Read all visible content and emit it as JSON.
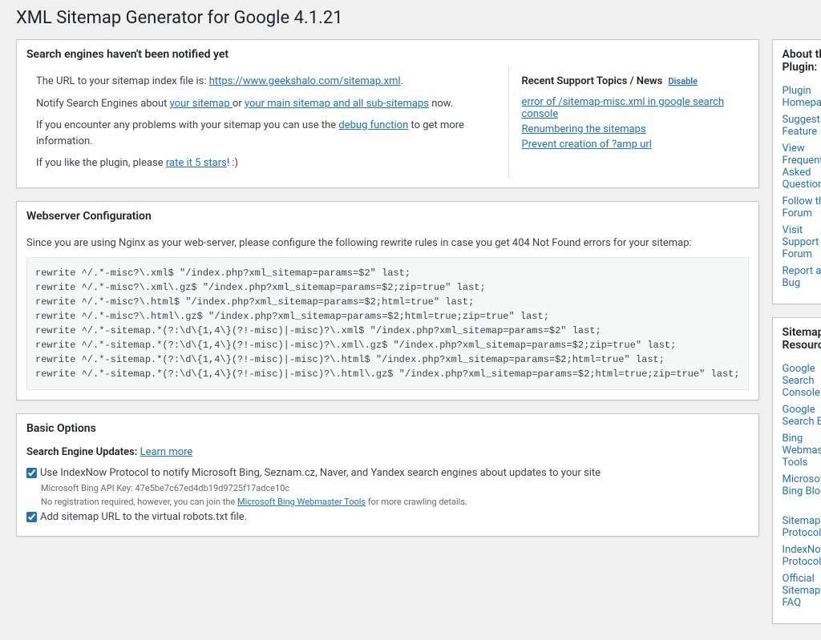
{
  "page_title": "XML Sitemap Generator for Google 4.1.21",
  "notify": {
    "heading": "Search engines haven't been notified yet",
    "line1_a": "The URL to your sitemap index file is: ",
    "line1_link": "https://www.geekshalo.com/sitemap.xml",
    "line1_b": ".",
    "line2_a": "Notify Search Engines about ",
    "line2_link1": "your sitemap ",
    "line2_mid": "or ",
    "line2_link2": "your main sitemap and all sub-sitemaps",
    "line2_b": " now.",
    "line3_a": "If you encounter any problems with your sitemap you can use the ",
    "line3_link": "debug function",
    "line3_b": " to get more information.",
    "line4_a": "If you like the plugin, please ",
    "line4_link": "rate it 5 stars",
    "line4_b": "! :)",
    "support_heading": "Recent Support Topics / News",
    "support_disable": "Disable",
    "support_items": [
      "error of /sitemap-misc.xml in google search console",
      "Renumbering the sitemaps",
      "Prevent creation of ?amp url"
    ]
  },
  "webserver": {
    "heading": "Webserver Configuration",
    "intro": "Since you are using Nginx as your web-server, please configure the following rewrite rules in case you get 404 Not Found errors for your sitemap:",
    "rules": "rewrite ^/.*-misc?\\.xml$ \"/index.php?xml_sitemap=params=$2\" last;\nrewrite ^/.*-misc?\\.xml\\.gz$ \"/index.php?xml_sitemap=params=$2;zip=true\" last;\nrewrite ^/.*-misc?\\.html$ \"/index.php?xml_sitemap=params=$2;html=true\" last;\nrewrite ^/.*-misc?\\.html\\.gz$ \"/index.php?xml_sitemap=params=$2;html=true;zip=true\" last;\nrewrite ^/.*-sitemap.*(?:\\d\\{1,4\\}(?!-misc)|-misc)?\\.xml$ \"/index.php?xml_sitemap=params=$2\" last;\nrewrite ^/.*-sitemap.*(?:\\d\\{1,4\\}(?!-misc)|-misc)?\\.xml\\.gz$ \"/index.php?xml_sitemap=params=$2;zip=true\" last;\nrewrite ^/.*-sitemap.*(?:\\d\\{1,4\\}(?!-misc)|-misc)?\\.html$ \"/index.php?xml_sitemap=params=$2;html=true\" last;\nrewrite ^/.*-sitemap.*(?:\\d\\{1,4\\}(?!-misc)|-misc)?\\.html\\.gz$ \"/index.php?xml_sitemap=params=$2;html=true;zip=true\" last;"
  },
  "basic": {
    "heading": "Basic Options",
    "sub_heading": "Search Engine Updates:",
    "learn_more": "Learn more",
    "opt_indexnow": "Use IndexNow Protocol to notify Microsoft Bing, Seznam.cz, Naver, and Yandex search engines about updates to your site",
    "bing_key_label": "Microsoft Bing API Key: 47e5be7c67ed4db19d9725f17adce10c",
    "bing_note_a": "No registration required, however, you can join the ",
    "bing_note_link": "Microsoft Bing Webmaster Tools",
    "bing_note_b": " for more crawling details.",
    "opt_robots": "Add sitemap URL to the virtual robots.txt file."
  },
  "about": {
    "heading": "About this Plugin:",
    "links": [
      "Plugin Homepage",
      "Suggest a Feature",
      "View Frequently Asked Questions",
      "Follow the Forum",
      "Visit Support Forum",
      "Report a Bug"
    ]
  },
  "resources": {
    "heading": "Sitemap Resources:",
    "group1": [
      "Google Search Console",
      "Google Search Blog",
      "Bing Webmaster Tools",
      "Microsoft Bing Blog"
    ],
    "group2": [
      "Sitemaps Protocol",
      "IndexNow Protocol",
      "Official Sitemaps FAQ"
    ]
  }
}
